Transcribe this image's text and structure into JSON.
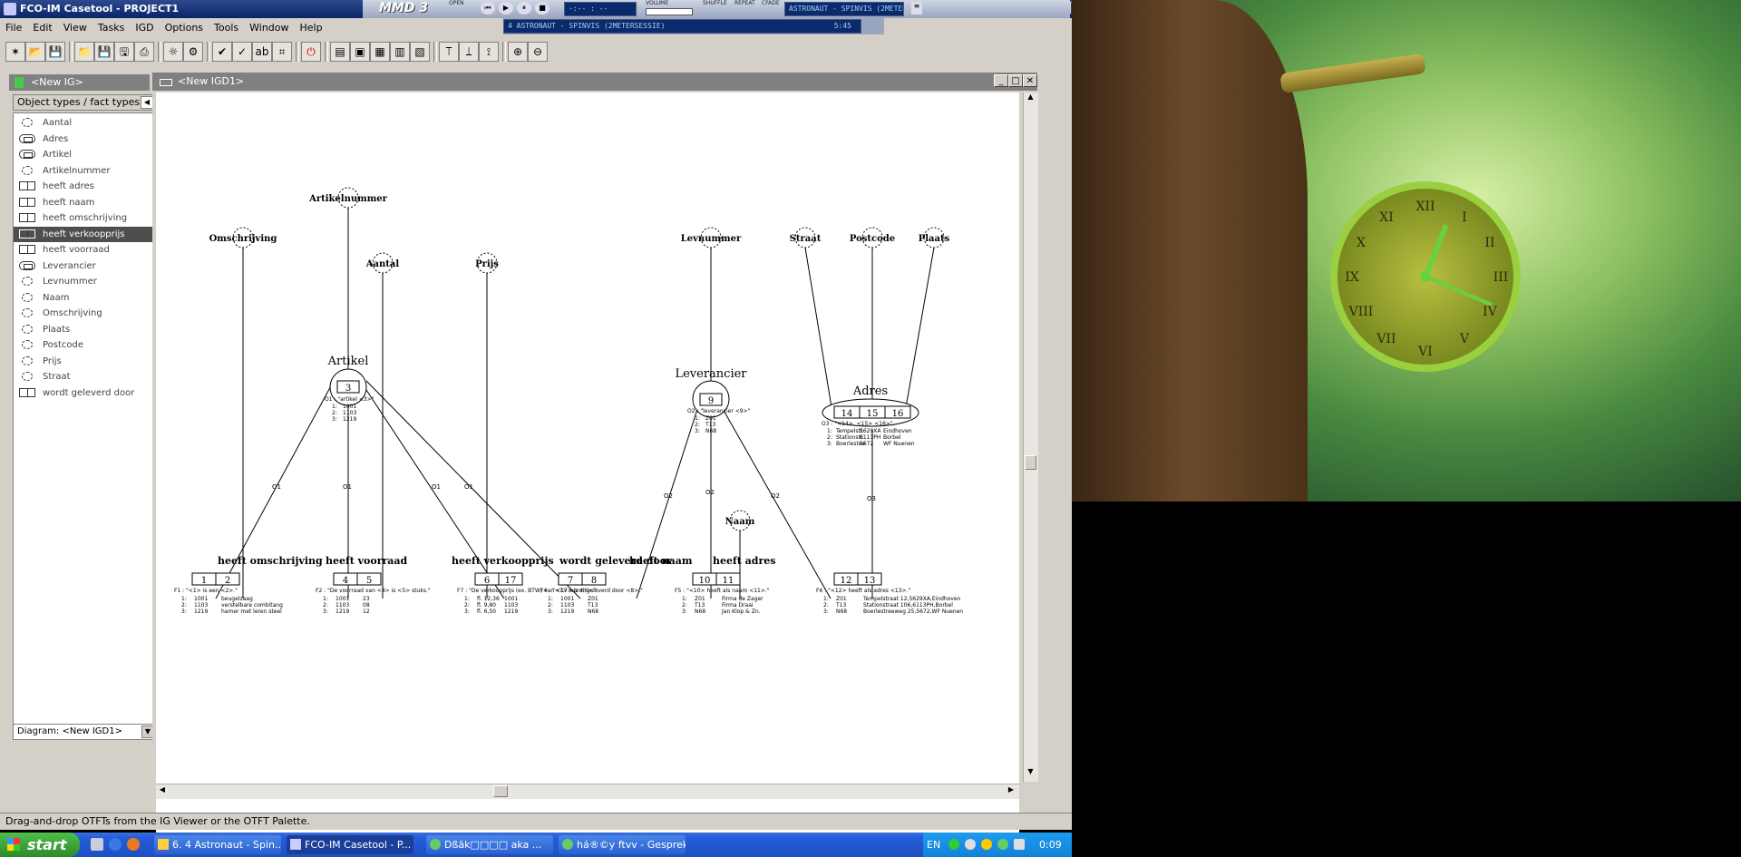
{
  "window": {
    "title": "FCO-IM Casetool - PROJECT1",
    "app_icon": "fco-app-icon"
  },
  "menu": [
    "File",
    "Edit",
    "View",
    "Tasks",
    "IGD",
    "Options",
    "Tools",
    "Window",
    "Help"
  ],
  "media_player": {
    "logo": "MMD 3",
    "tags": [
      "OPEN",
      "VOLUME",
      "SHUFFLE",
      "REPEAT",
      "CFADE"
    ],
    "track_title": "ASTRONAUT - SPINVIS (2METERSESSI",
    "track_title2": "4 ASTRONAUT - SPINVIS (2METERSESSIE)",
    "time": "5:45"
  },
  "left_panel": {
    "title": "<New IG>",
    "subtitle": "Object types / fact types",
    "items": [
      {
        "label": "Aantal",
        "icon": "label"
      },
      {
        "label": "Adres",
        "icon": "entity"
      },
      {
        "label": "Artikel",
        "icon": "entity"
      },
      {
        "label": "Artikelnummer",
        "icon": "label"
      },
      {
        "label": "heeft adres",
        "icon": "fact"
      },
      {
        "label": "heeft naam",
        "icon": "fact"
      },
      {
        "label": "heeft omschrijving",
        "icon": "fact"
      },
      {
        "label": "heeft verkoopprijs",
        "icon": "fact",
        "selected": true
      },
      {
        "label": "heeft voorraad",
        "icon": "fact"
      },
      {
        "label": "Leverancier",
        "icon": "entity"
      },
      {
        "label": "Levnummer",
        "icon": "label"
      },
      {
        "label": "Naam",
        "icon": "label"
      },
      {
        "label": "Omschrijving",
        "icon": "label"
      },
      {
        "label": "Plaats",
        "icon": "label"
      },
      {
        "label": "Postcode",
        "icon": "label"
      },
      {
        "label": "Prijs",
        "icon": "label"
      },
      {
        "label": "Straat",
        "icon": "label"
      },
      {
        "label": "wordt geleverd door",
        "icon": "fact"
      }
    ],
    "diagram_select": "Diagram: <New IGD1>"
  },
  "diagram_window": {
    "title": "<New IGD1>"
  },
  "diagram": {
    "labels": {
      "omschrijving": "Omschrijving",
      "artikelnummer": "Artikelnummer",
      "aantal": "Aantal",
      "prijs": "Prijs",
      "levnummer": "Levnummer",
      "straat": "Straat",
      "postcode": "Postcode",
      "plaats": "Plaats",
      "naam": "Naam"
    },
    "entities": {
      "artikel": "Artikel",
      "leverancier": "Leverancier",
      "adres": "Adres"
    },
    "entity_roles": {
      "artikel": "3",
      "leverancier": "9",
      "adres": [
        "14",
        "15",
        "16"
      ]
    },
    "entity_captions": {
      "artikel": "O1 : \"artikel <3>\"",
      "leverancier": "O2 : \"leverancier <9>\"",
      "adres": "O3 : \"<14>, <15> <16>\""
    },
    "entity_rows": {
      "artikel": [
        [
          "1:",
          "1001"
        ],
        [
          "2:",
          "1103"
        ],
        [
          "3:",
          "1219"
        ]
      ],
      "leverancier": [
        [
          "1:",
          "Z01"
        ],
        [
          "2:",
          "T13"
        ],
        [
          "3:",
          "N68"
        ]
      ],
      "adres": [
        [
          "1:",
          "Tempelstr.",
          "5629XA",
          "Eindhoven"
        ],
        [
          "2:",
          "Stationstr.",
          "6113PH",
          "Borbel"
        ],
        [
          "3:",
          "Boerlestee",
          "5672",
          "WF Nuenen"
        ]
      ]
    },
    "fact_types": [
      {
        "id": "omschr",
        "name": "heeft omschrijving",
        "roles": [
          "1",
          "2"
        ],
        "caption": "F1 : \"<1> is een <2>.\"",
        "rows": [
          [
            "1:",
            "1001",
            "beugelzaag"
          ],
          [
            "2:",
            "1103",
            "verstelbare combitang"
          ],
          [
            "3:",
            "1219",
            "hamer met leren steel"
          ]
        ]
      },
      {
        "id": "voorraad",
        "name": "heeft voorraad",
        "roles": [
          "4",
          "5"
        ],
        "caption": "F2 : \"De voorraad van <4> is <5> stuks.\"",
        "rows": [
          [
            "1:",
            "1001",
            "23"
          ],
          [
            "2:",
            "1103",
            "08"
          ],
          [
            "3:",
            "1219",
            "12"
          ]
        ]
      },
      {
        "id": "verkoop",
        "name": "heeft verkoopprijs",
        "roles": [
          "6",
          "17"
        ],
        "caption": "F7 : \"De verkoopprijs (ex. BTW) van <17> is <6>.\"",
        "rows": [
          [
            "1:",
            "fl. 12,36",
            "1001"
          ],
          [
            "2:",
            "fl. 9,80",
            "1103"
          ],
          [
            "3:",
            "fl. 6,50",
            "1219"
          ]
        ]
      },
      {
        "id": "geleverd",
        "name": "wordt geleverd door",
        "roles": [
          "7",
          "8"
        ],
        "caption": "F4 : \"<7> wordt geleverd door <8>.\"",
        "rows": [
          [
            "1:",
            "1001",
            "Z01"
          ],
          [
            "2:",
            "1103",
            "T13"
          ],
          [
            "3:",
            "1219",
            "N68"
          ]
        ]
      },
      {
        "id": "naam",
        "name": "heeft naam",
        "roles": [
          "10",
          "11"
        ],
        "caption": "F5 : \"<10> heeft als naam <11>.\"",
        "rows": [
          [
            "1:",
            "Z01",
            "Firma de Zager"
          ],
          [
            "2:",
            "T13",
            "Firma Draai"
          ],
          [
            "3:",
            "N68",
            "Jan Klop & Zn."
          ]
        ]
      },
      {
        "id": "adres",
        "name": "heeft adres",
        "roles": [
          "12",
          "13"
        ],
        "caption": "F6 : \"<12> heeft als adres <13>.\"",
        "rows": [
          [
            "1:",
            "Z01",
            "Tempelstraat 12,5629XA,Eindhoven"
          ],
          [
            "2:",
            "T13",
            "Stationstraat 106,6113PH,Borbel"
          ],
          [
            "3:",
            "N68",
            "Boerlestreeweg 25,5672,WF Nuenen"
          ]
        ]
      }
    ],
    "edge_labels": {
      "o1": "O1",
      "o2": "O2",
      "o3": "O3"
    }
  },
  "status_bar": "Drag-and-drop OTFTs from the IG Viewer or the OTFT Palette.",
  "taskbar": {
    "start": "start",
    "tasks": [
      {
        "label": "6. 4 Astronaut - Spin...",
        "icon": "media-player-icon"
      },
      {
        "label": "FCO-IM Casetool - P...",
        "icon": "fco-app-icon",
        "active": true
      },
      {
        "label": "Dßăk□□□□ aka ...",
        "icon": "messenger-icon"
      },
      {
        "label": "há®©y ftvv - Gesprek",
        "icon": "messenger-icon"
      }
    ],
    "language": "EN",
    "clock": "0:09"
  }
}
